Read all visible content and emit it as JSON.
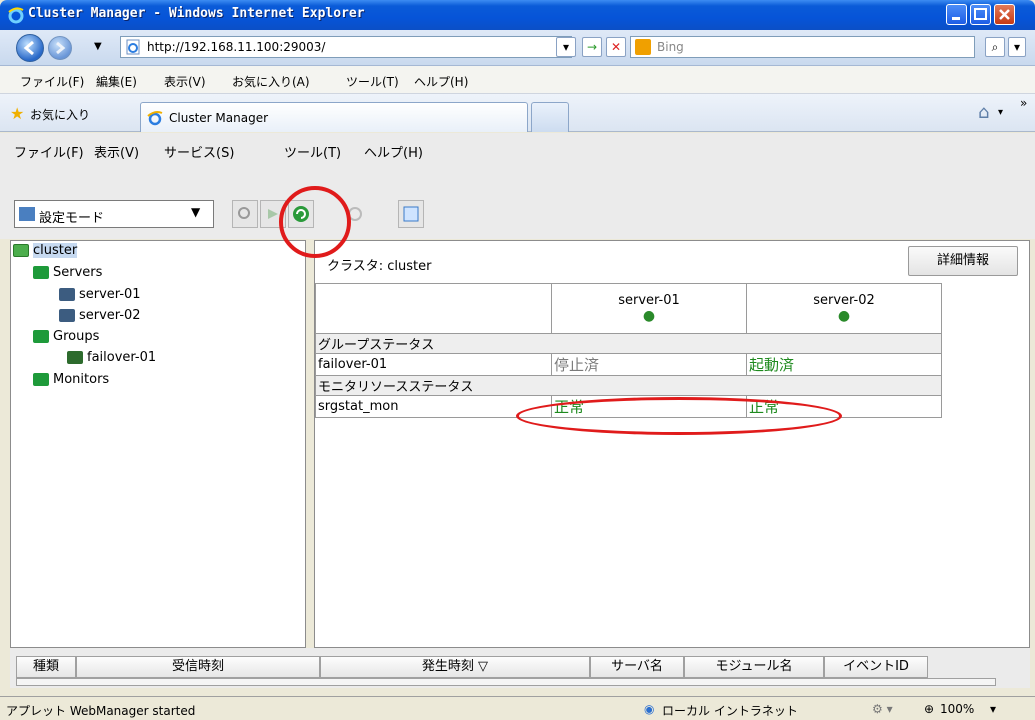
{
  "window": {
    "title": "Cluster Manager - Windows Internet Explorer"
  },
  "address": {
    "url": "http://192.168.11.100:29003/",
    "search_placeholder": "Bing"
  },
  "ie_menu": {
    "items": [
      "ファイル(F)",
      "編集(E)",
      "表示(V)",
      "お気に入り(A)",
      "ツール(T)",
      "ヘルプ(H)"
    ]
  },
  "favorites": {
    "label": "お気に入り",
    "tab_title": "Cluster Manager"
  },
  "app_menu": {
    "items": [
      "ファイル(F)",
      "表示(V)",
      "サービス(S)",
      "ツール(T)",
      "ヘルプ(H)"
    ]
  },
  "toolbar": {
    "mode": "設定モード"
  },
  "tree": {
    "root": "cluster",
    "servers_label": "Servers",
    "servers": [
      "server-01",
      "server-02"
    ],
    "groups_label": "Groups",
    "groups": [
      "failover-01"
    ],
    "monitors_label": "Monitors"
  },
  "panel": {
    "title": "クラスタ: cluster",
    "detail_button": "詳細情報",
    "columns": [
      "server-01",
      "server-02"
    ],
    "group_section": "グループステータス",
    "group_rows": [
      {
        "name": "failover-01",
        "values": [
          "停止済",
          "起動済"
        ]
      }
    ],
    "monitor_section": "モニタリソースステータス",
    "monitor_rows": [
      {
        "name": "srgstat_mon",
        "values": [
          "正常",
          "正常"
        ]
      }
    ]
  },
  "log": {
    "columns": [
      "種類",
      "受信時刻",
      "発生時刻 ▽",
      "サーバ名",
      "モジュール名",
      "イベントID"
    ]
  },
  "status": {
    "text": "アプレット WebManager started",
    "zone": "ローカル イントラネット",
    "zoom": "100%"
  },
  "colors": {
    "title_blue": "#0654d8",
    "ok_green": "#1e8a1e",
    "annotation_red": "#e01b1b"
  }
}
